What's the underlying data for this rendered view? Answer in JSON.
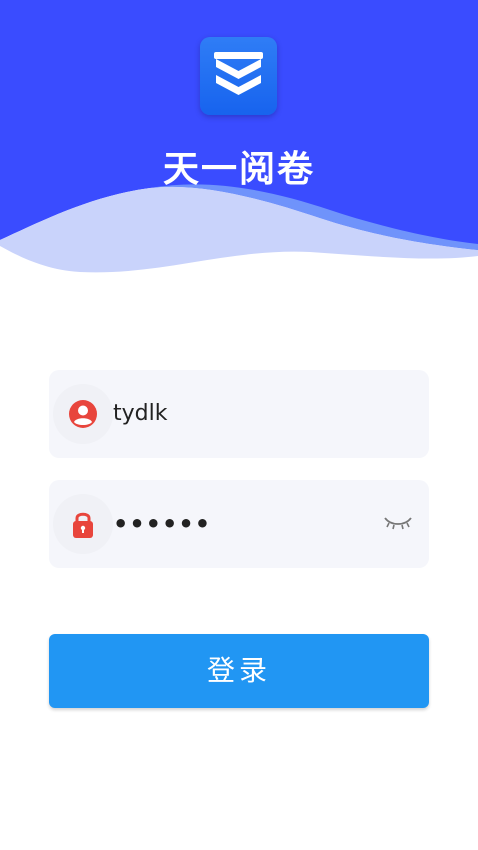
{
  "app": {
    "title": "天一阅卷",
    "logo_icon": "layered-chevron-logo-icon"
  },
  "colors": {
    "header_blue": "#3a4cff",
    "wave_light": "#c9d3fb",
    "button_blue": "#2196f3",
    "icon_red": "#e8453c"
  },
  "form": {
    "username": {
      "icon": "user-icon",
      "value": "tydlk"
    },
    "password": {
      "icon": "lock-icon",
      "value": "••••••",
      "toggle_icon": "eye-closed-icon"
    },
    "login_label": "登录"
  }
}
